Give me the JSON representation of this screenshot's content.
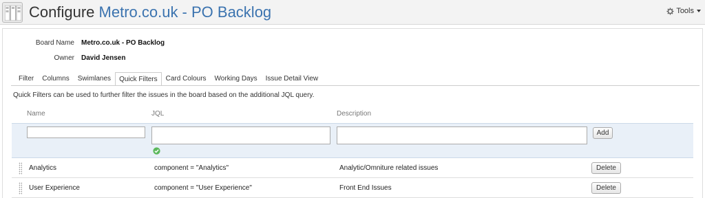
{
  "header": {
    "title_prefix": "Configure",
    "board_name": "Metro.co.uk - PO Backlog",
    "tools_label": "Tools"
  },
  "meta": {
    "board_name_label": "Board Name",
    "board_name_value": "Metro.co.uk - PO Backlog",
    "owner_label": "Owner",
    "owner_value": "David Jensen"
  },
  "tabs": [
    {
      "label": "Filter"
    },
    {
      "label": "Columns"
    },
    {
      "label": "Swimlanes"
    },
    {
      "label": "Quick Filters",
      "active": true
    },
    {
      "label": "Card Colours"
    },
    {
      "label": "Working Days"
    },
    {
      "label": "Issue Detail View"
    }
  ],
  "description": "Quick Filters can be used to further filter the issues in the board based on the additional JQL query.",
  "columns": {
    "name": "Name",
    "jql": "JQL",
    "description": "Description"
  },
  "new_filter": {
    "name_value": "",
    "jql_value": "",
    "description_value": "",
    "add_label": "Add",
    "jql_status": "valid"
  },
  "quick_filters": [
    {
      "name": "Analytics",
      "jql": "component = \"Analytics\"",
      "description": "Analytic/Omniture related issues",
      "delete_label": "Delete"
    },
    {
      "name": "User Experience",
      "jql": "component = \"User Experience\"",
      "description": "Front End Issues",
      "delete_label": "Delete"
    }
  ],
  "colors": {
    "link_blue": "#3b73af",
    "new_row_bg": "#e9f0f8",
    "ok_green": "#5cb85c"
  }
}
